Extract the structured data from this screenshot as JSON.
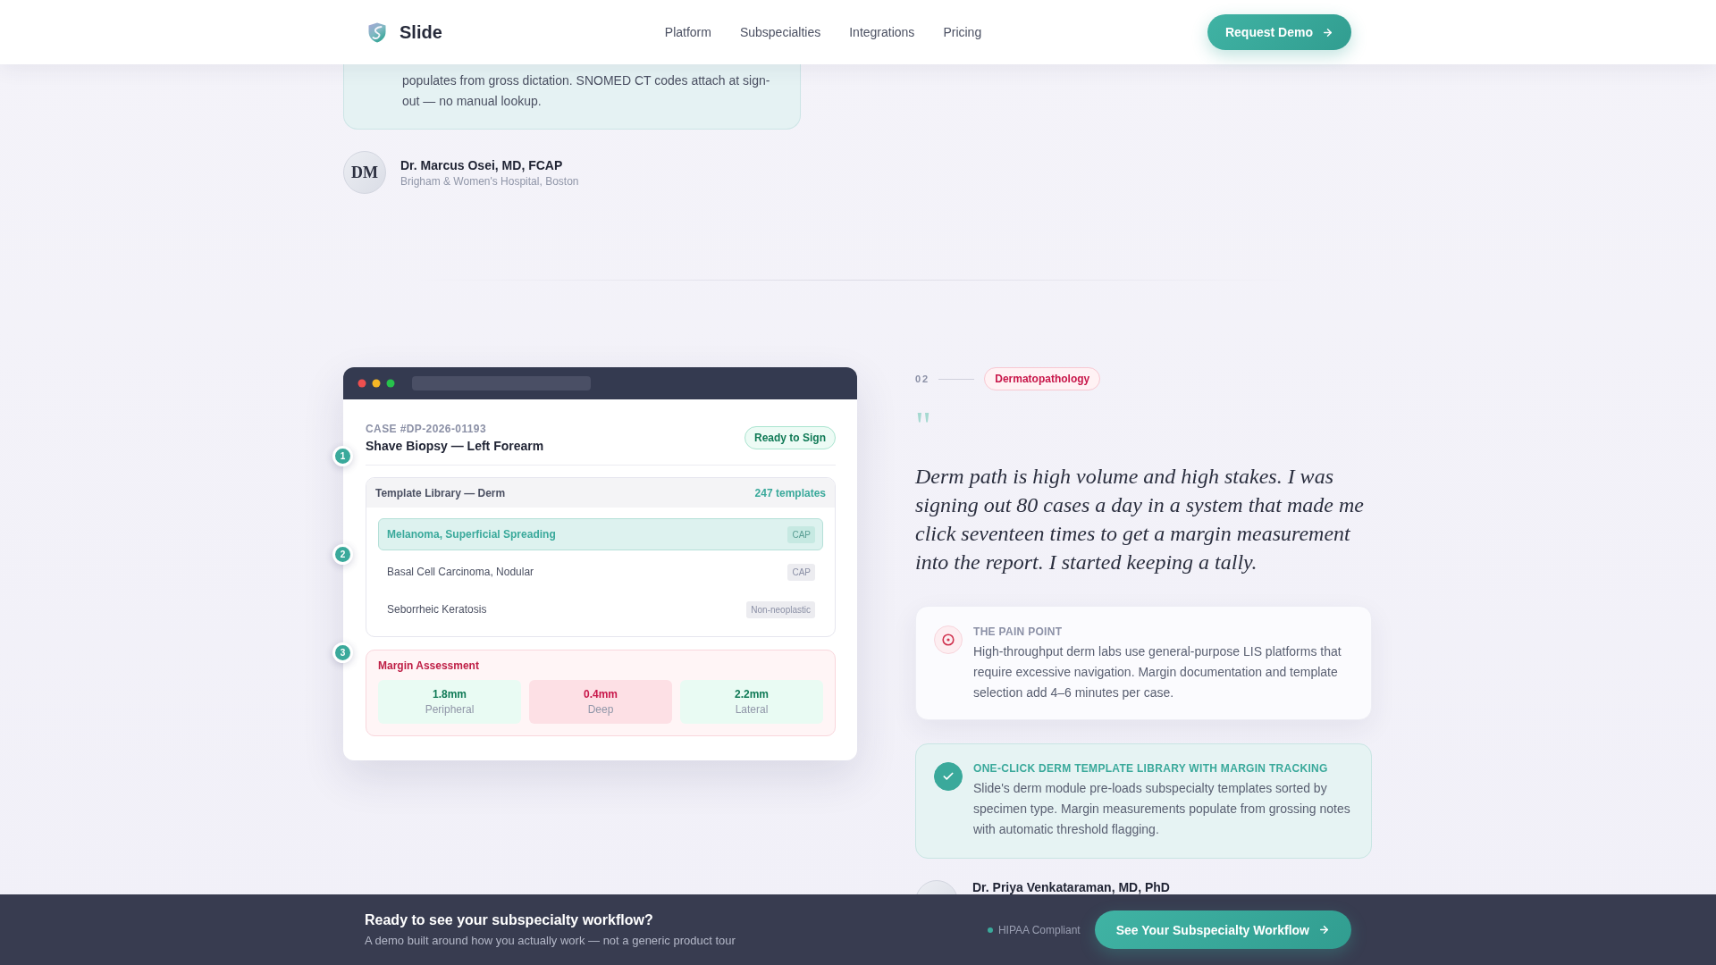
{
  "nav": {
    "brand": "Slide",
    "links": [
      {
        "label": "Platform"
      },
      {
        "label": "Subspecialties"
      },
      {
        "label": "Integrations"
      },
      {
        "label": "Pricing"
      }
    ],
    "cta": "Request Demo"
  },
  "previous_testimonial": {
    "quote": "populates from gross dictation. SNOMED CT codes attach at sign-out — no manual lookup.",
    "author": {
      "initials": "DM",
      "name": "Dr. Marcus Osei, MD, FCAP",
      "affiliation": "Brigham & Women's Hospital, Boston"
    }
  },
  "case_study": {
    "index": "02",
    "specialty": "Dermatopathology",
    "mockup": {
      "steps": [
        "1",
        "2",
        "3"
      ],
      "header": {
        "case_id": "CASE #DP-2026-01193",
        "title": "Shave Biopsy — Left Forearm",
        "status": "Ready to Sign"
      },
      "library": {
        "title": "Template Library — Derm",
        "count": "247 templates",
        "templates": [
          {
            "name": "Melanoma, Superficial Spreading",
            "tag": "CAP",
            "selected": true
          },
          {
            "name": "Basal Cell Carcinoma, Nodular",
            "tag": "CAP",
            "selected": false
          },
          {
            "name": "Seborrheic Keratosis",
            "tag": "Non-neoplastic",
            "selected": false
          }
        ]
      },
      "margins": {
        "title": "Margin Assessment",
        "items": [
          {
            "value": "1.8mm",
            "label": "Peripheral",
            "flagged": false
          },
          {
            "value": "0.4mm",
            "label": "Deep",
            "flagged": true
          },
          {
            "value": "2.2mm",
            "label": "Lateral",
            "flagged": false
          }
        ]
      }
    },
    "quote_mark": "\"",
    "quote": "Derm path is high volume and high stakes. I was signing out 80 cases a day in a system that made me click seventeen times to get a margin measurement into the report. I started keeping a tally.",
    "cards": [
      {
        "kind": "pain",
        "label": "THE PAIN POINT",
        "text": "High-throughput derm labs use general-purpose LIS platforms that require excessive navigation. Margin documentation and template selection add 4–6 minutes per case."
      },
      {
        "kind": "solution",
        "label": "ONE-CLICK DERM TEMPLATE LIBRARY WITH MARGIN TRACKING",
        "text": "Slide's derm module pre-loads subspecialty templates sorted by specimen type. Margin measurements populate from grossing notes with automatic threshold flagging."
      }
    ],
    "author": {
      "name": "Dr. Priya Venkataraman, MD, PhD"
    }
  },
  "cta_bar": {
    "title": "Ready to see your subspecialty workflow?",
    "subtitle": "A demo built around how you actually work — not a generic product tour",
    "badge": "HIPAA Compliant",
    "button": "See Your Subspecialty Workflow"
  }
}
